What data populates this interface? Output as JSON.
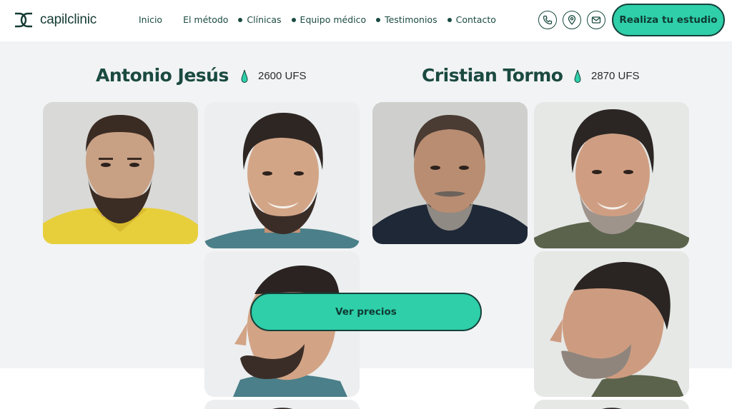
{
  "brand": {
    "name": "capilclinic",
    "accent": "#2ecfa9",
    "dark": "#1a4a40"
  },
  "nav": {
    "items": [
      {
        "label": "Inicio",
        "dot": false
      },
      {
        "label": "El método",
        "dot": false
      },
      {
        "label": "Clínicas",
        "dot": true
      },
      {
        "label": "Equipo médico",
        "dot": true
      },
      {
        "label": "Testimonios",
        "dot": true
      },
      {
        "label": "Contacto",
        "dot": true
      }
    ]
  },
  "header_icons": [
    "phone-icon",
    "location-pin-icon",
    "mail-icon"
  ],
  "header_cta": "Realiza tu estudio",
  "patients": [
    {
      "name": "Antonio Jesús",
      "ufs": "2600 UFS"
    },
    {
      "name": "Cristian Tormo",
      "ufs": "2870 UFS"
    }
  ],
  "main_cta": "Ver precios"
}
